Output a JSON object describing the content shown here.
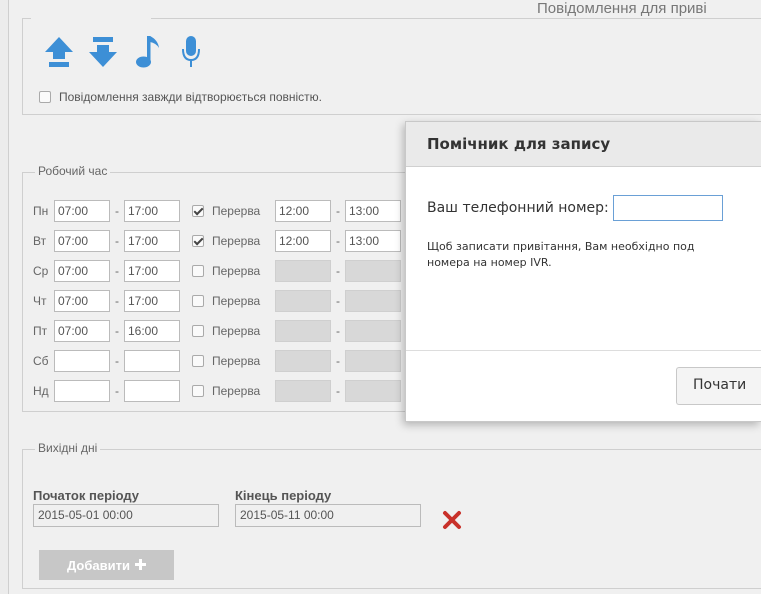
{
  "header": {
    "title": "Повідомлення для приві"
  },
  "messages": {
    "always_full_label": "Повідомлення завжди відтворюється повністю.",
    "icons": [
      "upload-arrow-icon",
      "download-arrow-icon",
      "music-note-icon",
      "microphone-icon"
    ]
  },
  "work_time": {
    "legend": "Робочий час",
    "break_label": "Перерва",
    "days": [
      {
        "label": "Пн",
        "start": "07:00",
        "end": "17:00",
        "break_checked": true,
        "break_start": "12:00",
        "break_end": "13:00"
      },
      {
        "label": "Вт",
        "start": "07:00",
        "end": "17:00",
        "break_checked": true,
        "break_start": "12:00",
        "break_end": "13:00"
      },
      {
        "label": "Ср",
        "start": "07:00",
        "end": "17:00",
        "break_checked": false,
        "break_start": "",
        "break_end": ""
      },
      {
        "label": "Чт",
        "start": "07:00",
        "end": "17:00",
        "break_checked": false,
        "break_start": "",
        "break_end": ""
      },
      {
        "label": "Пт",
        "start": "07:00",
        "end": "16:00",
        "break_checked": false,
        "break_start": "",
        "break_end": ""
      },
      {
        "label": "Сб",
        "start": "",
        "end": "",
        "break_checked": false,
        "break_start": "",
        "break_end": ""
      },
      {
        "label": "Нд",
        "start": "",
        "end": "",
        "break_checked": false,
        "break_start": "",
        "break_end": ""
      }
    ]
  },
  "holidays": {
    "legend": "Вихідні дні",
    "start_label": "Початок періоду",
    "end_label": "Кінець періоду",
    "start_value": "2015-05-01 00:00",
    "end_value": "2015-05-11 00:00",
    "add_button": "Добавити"
  },
  "dialog": {
    "title": "Помічник для запису",
    "phone_label": "Ваш телефонний номер:",
    "phone_value": "",
    "info_line1": "Щоб записати привітання, Вам необхідно под",
    "info_line2": "номера на номер IVR.",
    "start_button": "Почати"
  },
  "colors": {
    "accent_blue": "#3d8fd6",
    "delete_red": "#c8312a",
    "disabled_button": "#c7c7c7"
  }
}
